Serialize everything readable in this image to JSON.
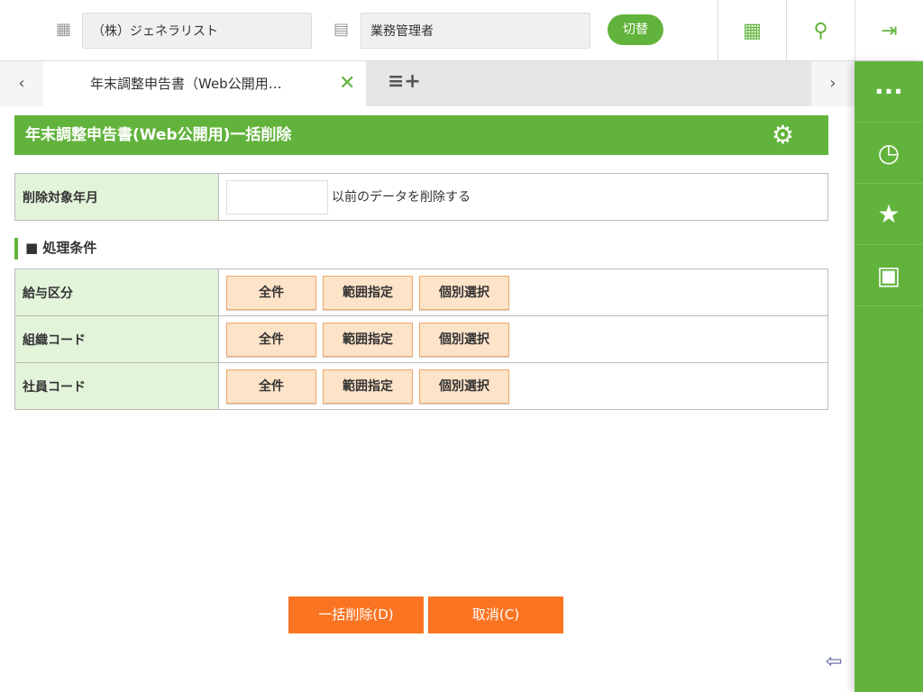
{
  "header": {
    "company": "（株）ジェネラリスト",
    "role": "業務管理者",
    "switch_label": "切替"
  },
  "tabs": {
    "active_label": "年末調整申告書（Web公開用…"
  },
  "page": {
    "title": "年末調整申告書(Web公開用)一括削除",
    "target_label": "削除対象年月",
    "target_value": "",
    "target_suffix": "以前のデータを削除する",
    "section_title": "■ 処理条件",
    "rows": [
      {
        "label": "給与区分"
      },
      {
        "label": "組織コード"
      },
      {
        "label": "社員コード"
      }
    ],
    "buttons": {
      "all": "全件",
      "range": "範囲指定",
      "individual": "個別選択"
    },
    "bulk_delete": "一括削除(D)",
    "cancel": "取消(C)"
  }
}
